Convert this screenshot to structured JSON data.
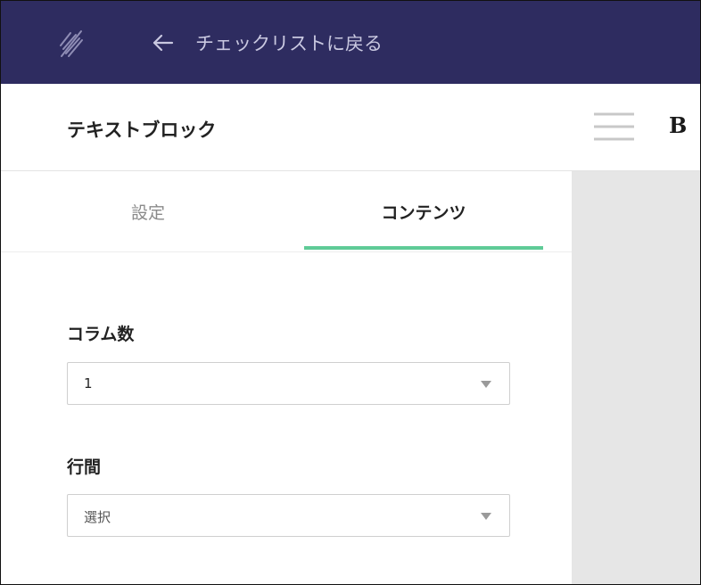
{
  "topbar": {
    "back_label": "チェックリストに戻る",
    "background_color": "#2e2c60"
  },
  "header": {
    "title": "テキストブロック",
    "bold_label": "B"
  },
  "tabs": [
    {
      "label": "設定",
      "active": false
    },
    {
      "label": "コンテンツ",
      "active": true
    }
  ],
  "accent_color": "#5fcb97",
  "fields": {
    "columns": {
      "label": "コラム数",
      "value": "1"
    },
    "line_spacing": {
      "label": "行間",
      "value": "選択"
    }
  },
  "icons": {
    "logo": "feather-logo-icon",
    "back": "arrow-left-icon",
    "menu": "hamburger-menu-icon",
    "caret": "caret-down-icon"
  }
}
